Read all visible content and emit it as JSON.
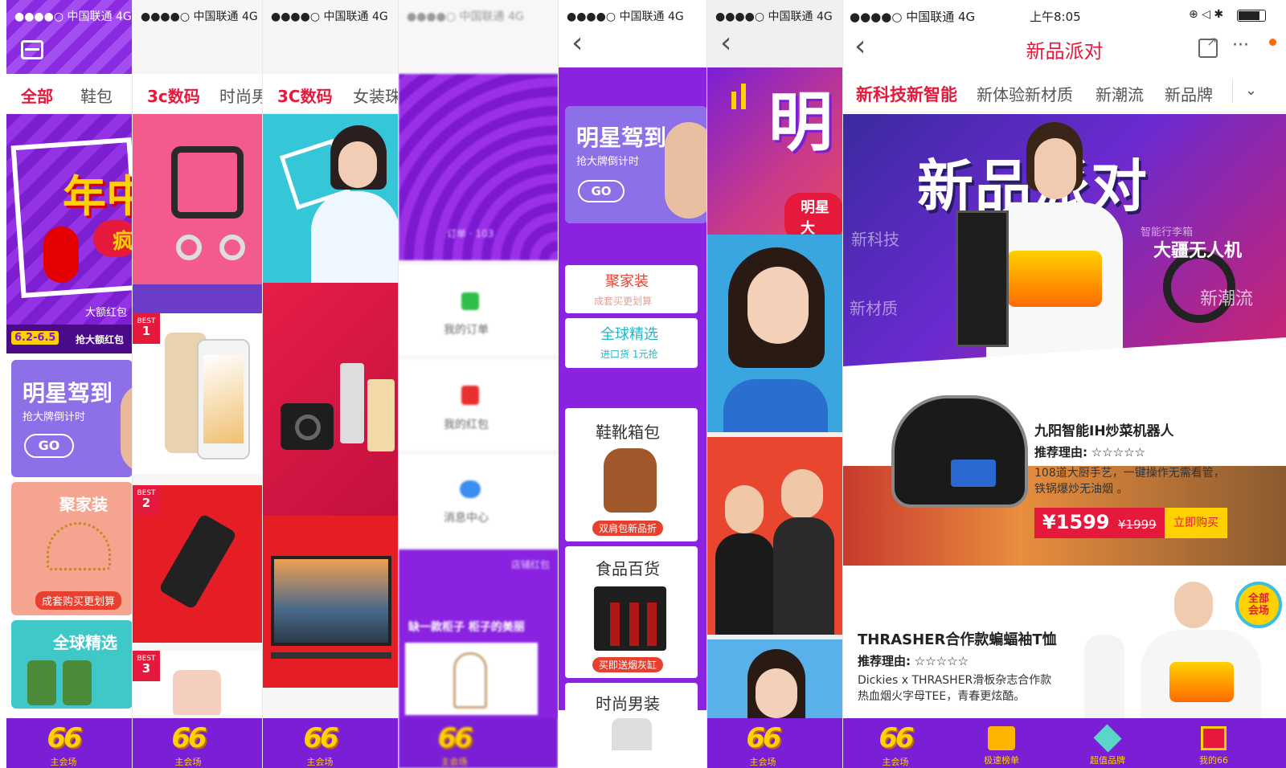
{
  "status": {
    "carrier": "●●●●○ 中国联通",
    "network": "4G",
    "time": "上午8:05"
  },
  "panel1": {
    "tabs": [
      "全部",
      "鞋包"
    ],
    "hero_text": "年中",
    "hero_badge": "疯",
    "hero_sub": "大额红包",
    "date_badge": "6.2-6.5",
    "date_text": "抢大额红包",
    "star_title": "明星驾到",
    "star_sub": "抢大牌倒计时",
    "go": "GO",
    "home_title": "聚家装",
    "home_btn": "成套购买更划算",
    "global_title": "全球精选"
  },
  "panel2": {
    "tabs": [
      "3c数码",
      "时尚男"
    ],
    "best_label": "BEST",
    "ranks": [
      "1",
      "2",
      "3"
    ]
  },
  "panel3": {
    "tabs": [
      "3C数码",
      "女装珠"
    ]
  },
  "panel4": {
    "order_hint": "订单 · 103",
    "menu": [
      "我的订单",
      "我的红包",
      "消息中心"
    ],
    "shop_hint": "店铺红包",
    "promo": "缺一款柜子  柜子的美丽"
  },
  "panel5": {
    "star_title": "明星驾到",
    "star_sub": "抢大牌倒计时",
    "go": "GO",
    "home_title": "聚家装",
    "home_sub": "成套买更划算",
    "global_title": "全球精选",
    "global_sub": "进口货 1元抢",
    "cats": [
      {
        "title": "鞋靴箱包",
        "tag": "双肩包新品折"
      },
      {
        "title": "食品百货",
        "tag": "买即送烟灰缸"
      },
      {
        "title": "时尚男装",
        "tag": ""
      }
    ]
  },
  "panel6": {
    "hero_char": "明",
    "hero_sub": "明星大"
  },
  "panel7": {
    "title": "新品派对",
    "tabs": [
      "新科技新智能",
      "新体验新材质",
      "新潮流",
      "新品牌"
    ],
    "banner_title": "新品派对",
    "banner_tags": [
      "新科技",
      "智能行李箱",
      "大疆无人机",
      "新潮流",
      "新材质"
    ],
    "product1": {
      "name": "九阳智能IH炒菜机器人",
      "reason_label": "推荐理由:",
      "stars": "☆☆☆☆☆",
      "desc1": "108道大厨手艺，一键操作无需看管，",
      "desc2": "铁锅爆炒无油烟 。",
      "price": "¥1599",
      "old_price": "¥1999",
      "buy": "立即购买"
    },
    "product2": {
      "name": "THRASHER合作款蝙蝠袖T恤",
      "reason_label": "推荐理由:",
      "stars": "☆☆☆☆☆",
      "desc1": "Dickies x THRASHER滑板杂志合作款",
      "desc2": "热血烟火字母TEE，青春更炫酷。"
    },
    "venue_badge": "全部会场",
    "nav": [
      "主会场",
      "极速榜单",
      "超值品牌",
      "我的66"
    ]
  },
  "nav_main": "主会场",
  "colors": {
    "accent_red": "#e5193c",
    "purple": "#7a1fd6",
    "yellow": "#ffd100"
  }
}
